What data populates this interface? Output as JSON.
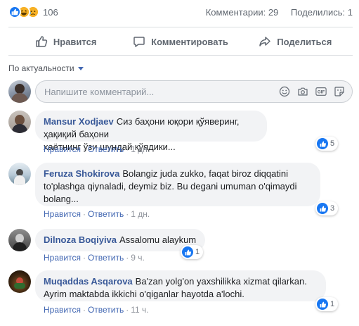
{
  "summary": {
    "reaction_count": "106",
    "comments_label": "Комментарии: 29",
    "shares_label": "Поделились: 1",
    "reaction_icons": [
      "like-icon",
      "haha-icon",
      "sad-icon"
    ]
  },
  "actions": {
    "like": "Нравится",
    "comment": "Комментировать",
    "share": "Поделиться"
  },
  "sort": {
    "label": "По актуальности"
  },
  "composer": {
    "placeholder": "Напишите комментарий..."
  },
  "comments": [
    {
      "author": "Mansur Xodjaev",
      "text_line1": "Сиз баҳони юқори қўяверинг, ҳақиқий баҳони",
      "text_line2": "хаётнинг ўзи шундай қўядики...",
      "like": "Нравится",
      "reply": "Ответить",
      "time": "1 дн.",
      "likes": "5"
    },
    {
      "author": "Feruza Shokirova",
      "text_line1": "Bolangiz juda zukko, faqat biroz diqqatini",
      "text_line2": "to'plashga qiynaladi, deymiz biz. Bu degani umuman o'qimaydi",
      "text_line3": "bolang...",
      "like": "Нравится",
      "reply": "Ответить",
      "time": "1 дн.",
      "likes": "3"
    },
    {
      "author": "Dilnoza Boqiyiva",
      "text_line1": "Assalomu alaykum",
      "like": "Нравится",
      "reply": "Ответить",
      "time": "9 ч.",
      "likes": "1"
    },
    {
      "author": "Muqaddas Asqarova",
      "text_line1": "Ba'zan yolg'on yaxshilikka xizmat qilarkan.",
      "text_line2": "Ayrim maktabda ikkichi o'qiganlar hayotda a'lochi.",
      "like": "Нравится",
      "reply": "Ответить",
      "time": "11 ч.",
      "likes": "1"
    }
  ],
  "colors": {
    "accent": "#4267b2",
    "author": "#385898",
    "like_blue": "#1877f2",
    "bubble_bg": "#f2f3f5"
  }
}
